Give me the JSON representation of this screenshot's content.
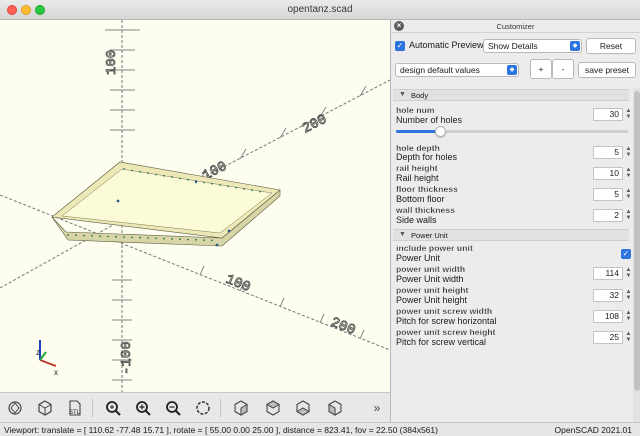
{
  "window": {
    "title": "opentanz.scad"
  },
  "viewport": {
    "axis_labels": [
      "100",
      "200",
      "100",
      "200",
      "100",
      "-100"
    ]
  },
  "toolbar": {
    "icons": [
      "preview-render-icon",
      "render-icon",
      "export-stl-icon",
      "zoom-all-icon",
      "zoom-in-icon",
      "zoom-out-icon",
      "reset-view-icon",
      "view-right-icon",
      "view-top-icon",
      "view-bottom-icon",
      "view-left-icon"
    ],
    "more": "»",
    "stl_label": "STL"
  },
  "status": {
    "viewport": "Viewport: translate = [ 110.62 -77.48 15.71 ], rotate = [ 55.00 0.00 25.00 ], distance = 823.41, fov = 22.50 (384x561)",
    "version": "OpenSCAD 2021.01"
  },
  "customizer": {
    "title": "Customizer",
    "auto_preview_label": "Automatic Preview",
    "auto_preview_checked": true,
    "details_select": "Show Details",
    "reset_label": "Reset",
    "preset_select": "design default values",
    "plus_label": "+",
    "minus_label": "-",
    "save_preset_label": "save preset",
    "groups": [
      {
        "name": "Body",
        "params": [
          {
            "name": "hole num",
            "desc": "Number of holes",
            "value": "30",
            "slider": 0.19
          },
          {
            "name": "hole depth",
            "desc": "Depth for holes",
            "value": "5"
          },
          {
            "name": "rail height",
            "desc": "Rail height",
            "value": "10"
          },
          {
            "name": "floor thickness",
            "desc": "Bottom floor",
            "value": "5"
          },
          {
            "name": "wall thickness",
            "desc": "Side walls",
            "value": "2"
          }
        ]
      },
      {
        "name": "Power Unit",
        "params": [
          {
            "name": "include power unit",
            "desc": "Power Unit",
            "checked": true
          },
          {
            "name": "power unit width",
            "desc": "Power Unit width",
            "value": "114"
          },
          {
            "name": "power unit height",
            "desc": "Power Unit height",
            "value": "32"
          },
          {
            "name": "power unit screw width",
            "desc": "Pitch for screw  horizontal",
            "value": "108"
          },
          {
            "name": "power unit screw height",
            "desc": "Pitch for screw vertical",
            "value": "25"
          }
        ]
      }
    ]
  },
  "colors": {
    "accent": "#2d74e0",
    "model_top": "#fbfbd8",
    "model_side": "#d8d5a6",
    "axis": "#555555"
  }
}
